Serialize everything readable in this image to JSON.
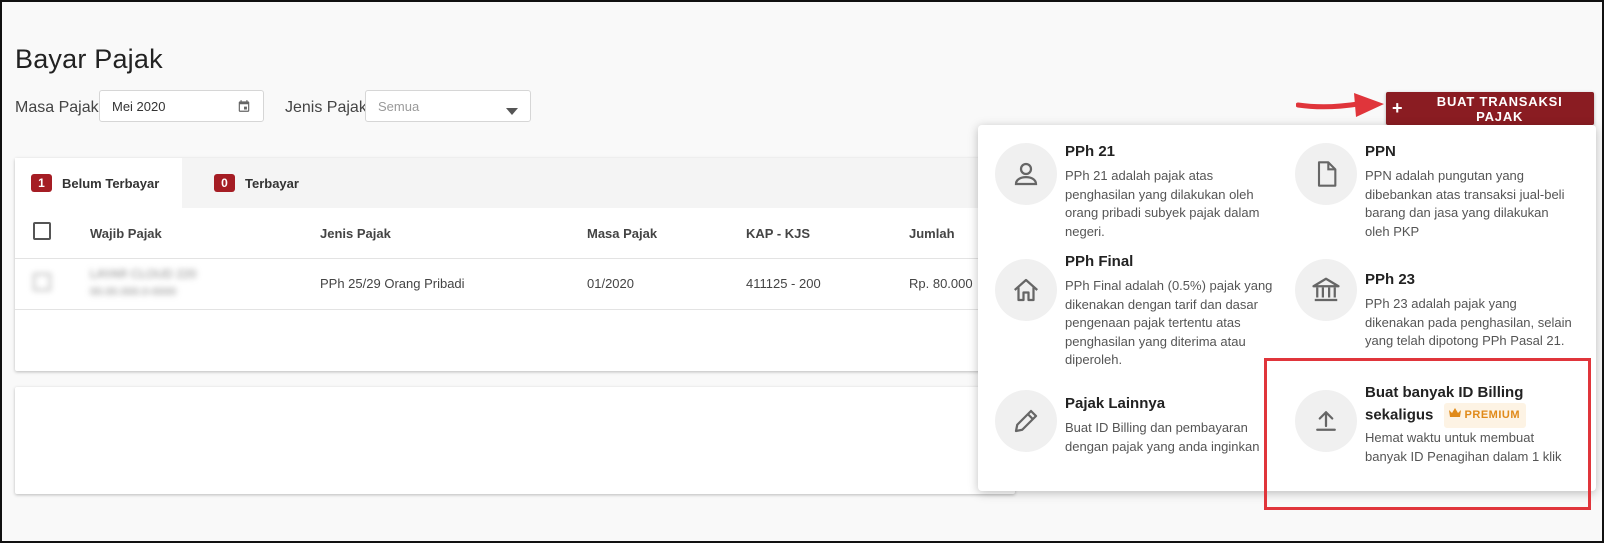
{
  "page": {
    "title": "Bayar Pajak"
  },
  "filters": {
    "masa_label": "Masa Pajak",
    "masa_value": "Mei 2020",
    "jenis_label": "Jenis Pajak",
    "jenis_placeholder": "Semua"
  },
  "action": {
    "create_label": "BUAT TRANSAKSI PAJAK",
    "create_icon": "plus-icon"
  },
  "tabs": [
    {
      "count": "1",
      "label": "Belum Terbayar",
      "active": true
    },
    {
      "count": "0",
      "label": "Terbayar",
      "active": false
    }
  ],
  "table": {
    "columns": [
      "Wajib Pajak",
      "Jenis Pajak",
      "Masa Pajak",
      "KAP - KJS",
      "Jumlah"
    ],
    "rows": [
      {
        "wajib_name": "LAYAR CLOUD 220",
        "wajib_npwp": "00.00.000.0-0000",
        "jenis": "PPh 25/29 Orang Pribadi",
        "masa": "01/2020",
        "kap": "411125 - 200",
        "jumlah": "Rp. 80.000"
      }
    ]
  },
  "menu": {
    "options": [
      {
        "title": "PPh 21",
        "desc": "PPh 21 adalah pajak atas penghasilan yang dilakukan oleh orang pribadi subyek pajak dalam negeri.",
        "icon": "person-icon"
      },
      {
        "title": "PPN",
        "desc": "PPN adalah pungutan yang dibebankan atas transaksi jual-beli barang dan jasa yang dilakukan oleh PKP",
        "icon": "document-icon"
      },
      {
        "title": "PPh Final",
        "desc": "PPh Final adalah (0.5%) pajak yang dikenakan dengan tarif dan dasar pengenaan pajak tertentu atas penghasilan yang diterima atau diperoleh.",
        "icon": "home-icon"
      },
      {
        "title": "PPh 23",
        "desc": "PPh 23 adalah pajak yang dikenakan pada penghasilan, selain yang telah dipotong PPh Pasal 21.",
        "icon": "bank-icon"
      },
      {
        "title": "Pajak Lainnya",
        "desc": "Buat ID Billing dan pembayaran dengan pajak yang anda inginkan",
        "icon": "pencil-icon"
      },
      {
        "title": "Buat banyak ID Billing sekaligus",
        "desc": "Hemat waktu untuk membuat banyak ID Penagihan dalam 1 klik",
        "icon": "upload-icon",
        "badge": "PREMIUM"
      }
    ]
  },
  "colors": {
    "primary": "#8a1c22",
    "badge": "#a51d24",
    "premium": "#e08a1a",
    "highlight": "#e0353b"
  }
}
